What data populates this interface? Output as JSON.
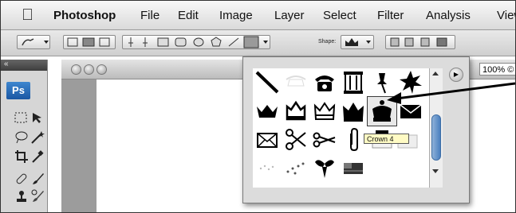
{
  "menubar": {
    "app_name": "Photoshop",
    "items": [
      "File",
      "Edit",
      "Image",
      "Layer",
      "Select",
      "Filter",
      "Analysis",
      "View"
    ]
  },
  "options_bar": {
    "shape_label": "Shape:"
  },
  "tools_panel": {
    "header": "«",
    "logo": "Ps"
  },
  "document": {
    "zoom": "100% ©"
  },
  "shape_picker": {
    "tooltip": "Crown 4",
    "flyout_icon": "▶",
    "shapes": [
      "slash-line-icon",
      "ghost-phone-icon",
      "telephone-icon",
      "scroll-frame-icon",
      "thumbtack-icon",
      "star-seal-icon",
      "crown-1-icon",
      "crown-2-icon",
      "crown-3-icon",
      "crown-4-icon",
      "crown-5-icon",
      "envelope-fill-icon",
      "envelope-icon",
      "scissors-icon",
      "scissors-alt-icon",
      "paperclip-icon",
      "field-icon",
      "blank-icon",
      "dots-icon",
      "dots-swoosh-icon",
      "fleur-icon",
      "flag-icon"
    ]
  },
  "colors": {
    "menubar_top": "#f8f8f8",
    "menubar_bottom": "#dadada",
    "accent_blue": "#3e86cf",
    "tooltip_bg": "#fffbc4"
  }
}
